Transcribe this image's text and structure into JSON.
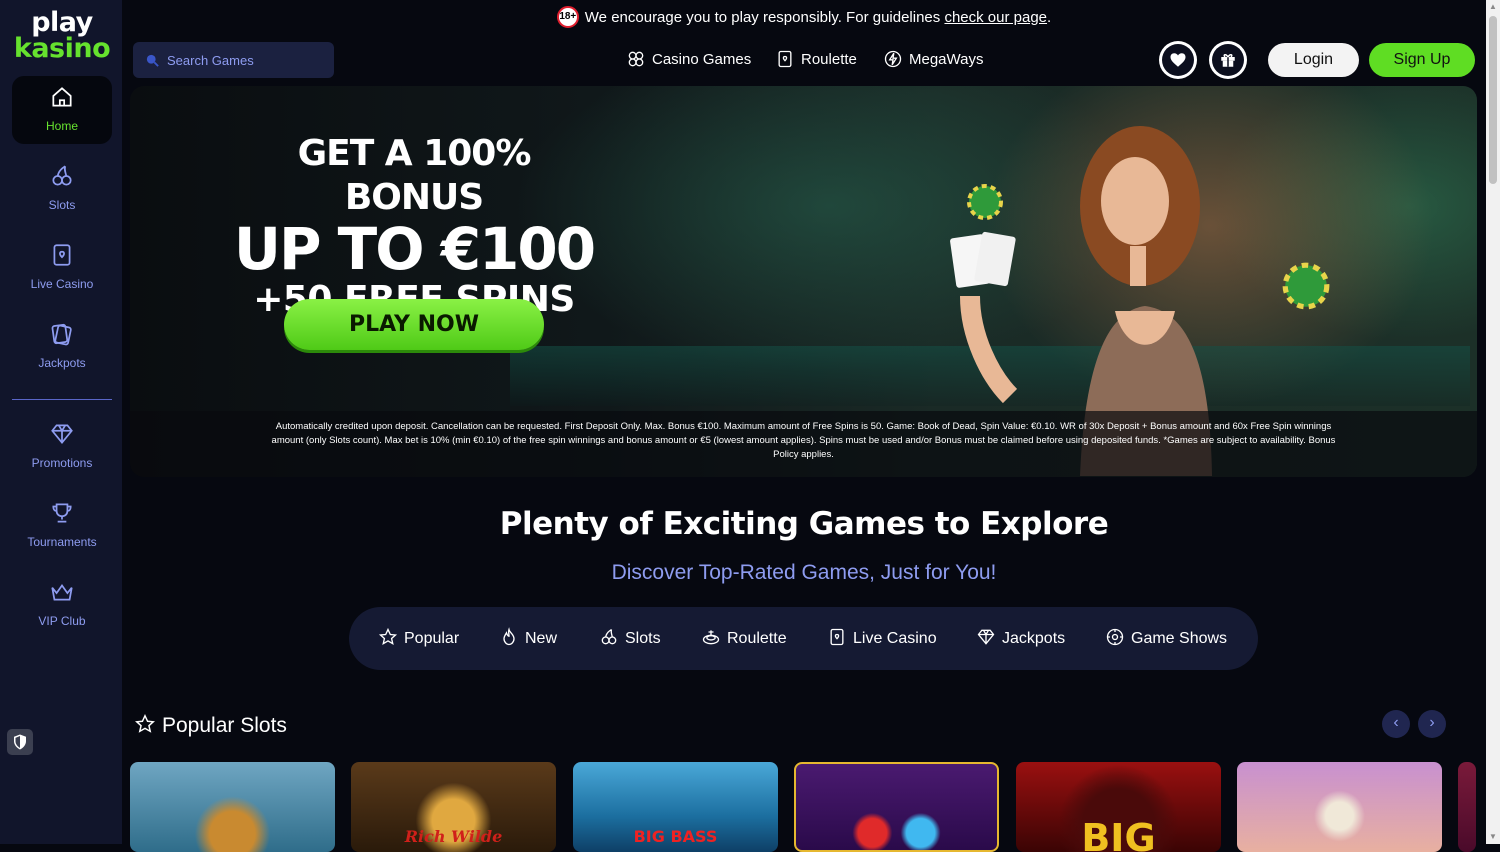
{
  "logo": {
    "line1": "play",
    "line2": "kasino"
  },
  "sidebar": {
    "items": [
      {
        "label": "Home",
        "icon": "home-icon",
        "active": true
      },
      {
        "label": "Slots",
        "icon": "cherry-icon"
      },
      {
        "label": "Live Casino",
        "icon": "card-icon"
      },
      {
        "label": "Jackpots",
        "icon": "cards-stack-icon"
      },
      {
        "label": "Promotions",
        "icon": "diamond-icon"
      },
      {
        "label": "Tournaments",
        "icon": "trophy-icon"
      },
      {
        "label": "VIP Club",
        "icon": "crown-icon"
      }
    ]
  },
  "responsible": {
    "badge": "18+",
    "text": "We encourage you to play responsibly. For guidelines ",
    "link": "check our page",
    "suffix": "."
  },
  "header": {
    "search_placeholder": "Search Games",
    "nav": [
      {
        "label": "Casino Games",
        "icon": "clover-icon"
      },
      {
        "label": "Roulette",
        "icon": "card-icon"
      },
      {
        "label": "MegaWays",
        "icon": "megaways-icon"
      }
    ],
    "login": "Login",
    "signup": "Sign Up"
  },
  "hero": {
    "line1": "GET A 100% BONUS",
    "line2": "UP TO €100",
    "line3": "+50 FREE SPINS",
    "cta": "PLAY NOW",
    "terms": "Automatically credited upon deposit. Cancellation can be requested. First Deposit Only. Max. Bonus €100. Maximum amount of Free Spins is 50. Game: Book of Dead, Spin Value: €0.10. WR of 30x Deposit + Bonus amount and 60x Free Spin winnings amount (only Slots count). Max bet is 10% (min €0.10) of the free spin winnings and bonus amount or €5 (lowest amount applies). Spins must be used and/or Bonus must be claimed before using deposited funds. *Games are subject to availability. Bonus Policy applies."
  },
  "section": {
    "title": "Plenty of Exciting Games to Explore",
    "subtitle": "Discover Top-Rated Games, Just for You!",
    "categories": [
      {
        "label": "Popular",
        "icon": "star-icon"
      },
      {
        "label": "New",
        "icon": "flame-icon"
      },
      {
        "label": "Slots",
        "icon": "cherry-icon"
      },
      {
        "label": "Roulette",
        "icon": "roulette-icon"
      },
      {
        "label": "Live Casino",
        "icon": "card-icon"
      },
      {
        "label": "Jackpots",
        "icon": "diamond-icon"
      },
      {
        "label": "Game Shows",
        "icon": "gameshow-icon"
      }
    ]
  },
  "popular": {
    "title": "Popular Slots",
    "prev": "‹",
    "next": "›",
    "tiles": [
      {
        "name": "fishing-slot",
        "caption": ""
      },
      {
        "name": "rich-wilde-slot",
        "caption": "Rich Wilde"
      },
      {
        "name": "big-bass-slot",
        "caption": "BIG BASS"
      },
      {
        "name": "gems-slot",
        "caption": ""
      },
      {
        "name": "big-slot",
        "caption": "BIG"
      },
      {
        "name": "zeus-slot",
        "caption": ""
      }
    ]
  }
}
